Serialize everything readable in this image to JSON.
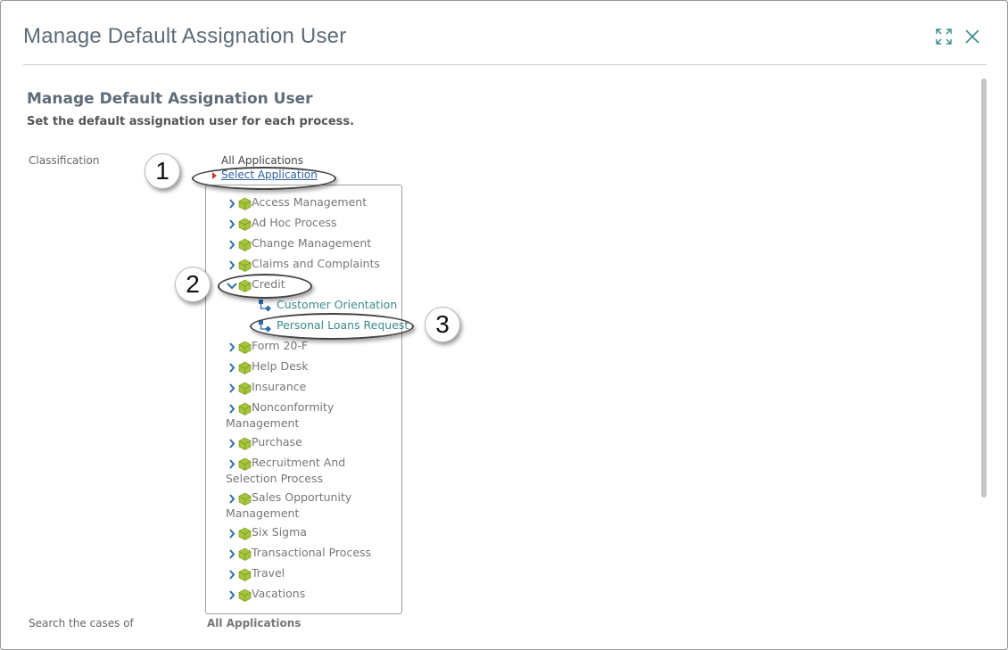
{
  "dialog": {
    "title": "Manage Default Assignation User",
    "icons": {
      "maximize": "maximize-icon",
      "close": "close-icon"
    }
  },
  "content": {
    "title": "Manage Default Assignation User",
    "subtitle": "Set the default assignation user for each process."
  },
  "classification": {
    "label": "Classification",
    "all_applications": "All Applications",
    "select_application": "Select Application"
  },
  "tree": {
    "nodes": [
      {
        "label": "Access Management",
        "expanded": false
      },
      {
        "label": "Ad Hoc Process",
        "expanded": false
      },
      {
        "label": "Change Management",
        "expanded": false
      },
      {
        "label": "Claims and Complaints",
        "expanded": false
      },
      {
        "label": "Credit",
        "expanded": true
      },
      {
        "label": "Form 20-F",
        "expanded": false
      },
      {
        "label": "Help Desk",
        "expanded": false
      },
      {
        "label": "Insurance",
        "expanded": false
      },
      {
        "label": "Nonconformity Management",
        "expanded": false
      },
      {
        "label": "Purchase",
        "expanded": false
      },
      {
        "label": "Recruitment And Selection Process",
        "expanded": false
      },
      {
        "label": "Sales Opportunity Management",
        "expanded": false
      },
      {
        "label": "Six Sigma",
        "expanded": false
      },
      {
        "label": "Transactional Process",
        "expanded": false
      },
      {
        "label": "Travel",
        "expanded": false
      },
      {
        "label": "Vacations",
        "expanded": false
      }
    ],
    "credit_children": [
      {
        "label": "Customer Orientation"
      },
      {
        "label": "Personal Loans Request"
      }
    ]
  },
  "callouts": [
    "1",
    "2",
    "3"
  ],
  "search": {
    "label": "Search the cases of",
    "value": "All Applications"
  },
  "colors": {
    "accent": "#3a8a8a",
    "link": "#2b62a0",
    "cube": "#a7c53a",
    "chevron": "#2f6da8"
  }
}
